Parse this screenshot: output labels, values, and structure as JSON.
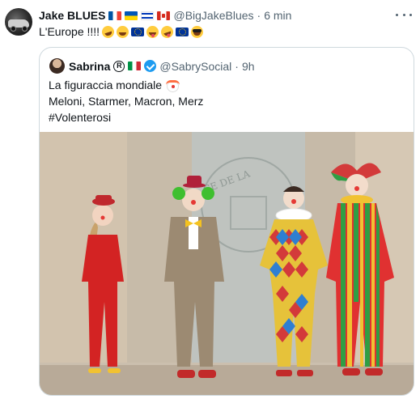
{
  "tweet": {
    "author": {
      "display_name": "Jake BLUES",
      "flags": [
        "flag-france",
        "flag-ukraine",
        "flag-israel",
        "flag-canada"
      ],
      "handle": "@BigJakeBlues",
      "separator": "·",
      "time": "6 min"
    },
    "more_icon": "more-horizontal-icon",
    "text": "L'Europe !!!!",
    "emojis": [
      "rolling-on-floor-laughing",
      "tears-of-joy",
      "flag-eu",
      "winking-tongue",
      "zany-face",
      "flag-eu",
      "sunglasses-face"
    ]
  },
  "quote": {
    "author": {
      "display_name": "Sabrina",
      "registered_symbol": "R",
      "flag": "flag-italy",
      "verified_icon": "verified-badge-icon",
      "handle": "@SabrySocial",
      "separator": "·",
      "time": "9h"
    },
    "lines": [
      "La figuraccia mondiale",
      "Meloni, Starmer, Macron, Merz",
      "#Volenterosi"
    ],
    "line1_emoji": "clown-face",
    "image": {
      "description_icon": "photo-image",
      "wall_lettering": "CE DE LA"
    }
  },
  "colors": {
    "text_primary": "#0f1419",
    "text_secondary": "#536471",
    "border": "#cfd9de",
    "verified": "#1d9bf0"
  }
}
